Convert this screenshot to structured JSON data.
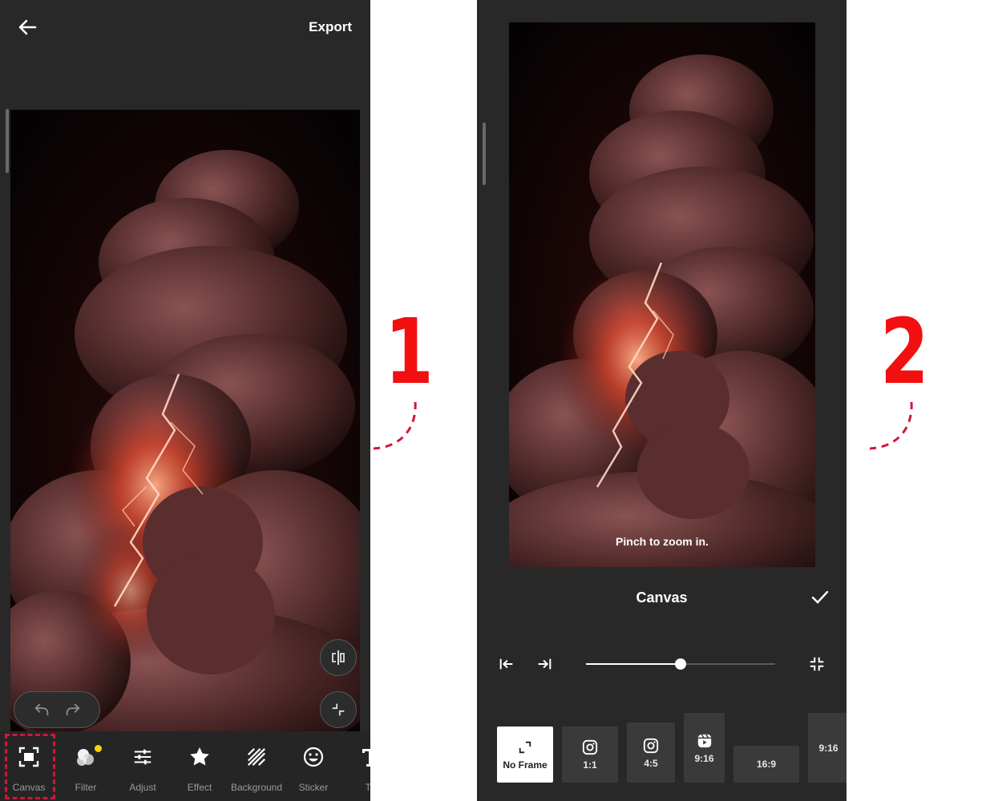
{
  "step1": {
    "number": "1",
    "header": {
      "export_label": "Export"
    },
    "toolbar": {
      "items": [
        {
          "label": "Canvas",
          "icon": "canvas-frame-icon"
        },
        {
          "label": "Filter",
          "icon": "filter-circles-icon"
        },
        {
          "label": "Adjust",
          "icon": "sliders-icon"
        },
        {
          "label": "Effect",
          "icon": "star-icon"
        },
        {
          "label": "Background",
          "icon": "stripes-icon"
        },
        {
          "label": "Sticker",
          "icon": "smiley-icon"
        },
        {
          "label": "Te",
          "icon": "text-icon"
        }
      ],
      "highlighted": "Canvas"
    }
  },
  "step2": {
    "number": "2",
    "hint": "Pinch to zoom in.",
    "sheet": {
      "title": "Canvas",
      "border_slider": 0.5
    },
    "ratios": [
      {
        "label": "No Frame",
        "icon": "expand-icon",
        "selected": true
      },
      {
        "label": "1:1",
        "icon": "instagram-icon"
      },
      {
        "label": "4:5",
        "icon": "instagram-icon"
      },
      {
        "label": "9:16",
        "icon": "reels-icon"
      },
      {
        "label": "16:9",
        "icon": ""
      },
      {
        "label": "9:16",
        "icon": ""
      }
    ]
  },
  "colors": {
    "annotation": "#f10f0f",
    "highlight_box": "#d6143a",
    "panel_bg": "#282828",
    "filter_dot": "#f4d40a"
  }
}
